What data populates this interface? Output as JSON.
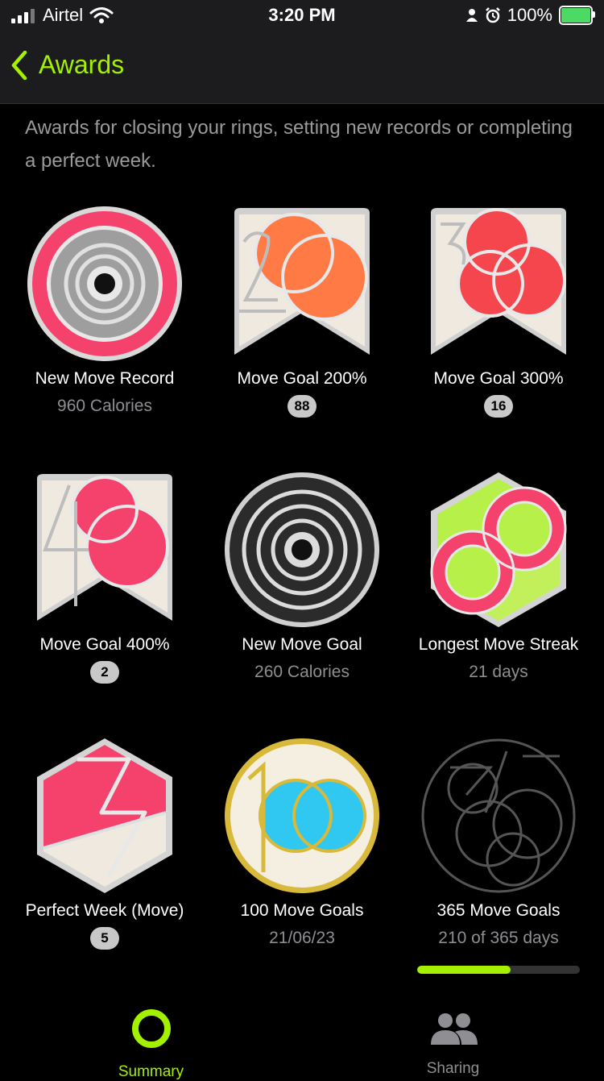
{
  "status": {
    "carrier": "Airtel",
    "time": "3:20 PM",
    "battery": "100%",
    "battery_level": 1.0
  },
  "nav": {
    "title": "Awards"
  },
  "description": "Awards for closing your rings, setting new records or completing a perfect week.",
  "awards": [
    {
      "title": "New Move Record",
      "subtitle": "960 Calories"
    },
    {
      "title": "Move Goal 200%",
      "count": "88"
    },
    {
      "title": "Move Goal 300%",
      "count": "16"
    },
    {
      "title": "Move Goal 400%",
      "count": "2"
    },
    {
      "title": "New Move Goal",
      "subtitle": "260 Calories"
    },
    {
      "title": "Longest Move Streak",
      "subtitle": "21 days"
    },
    {
      "title": "Perfect Week (Move)",
      "count": "5"
    },
    {
      "title": "100 Move Goals",
      "subtitle": "21/06/23"
    },
    {
      "title": "365 Move Goals",
      "subtitle": "210 of 365 days",
      "progress": 0.575
    }
  ],
  "tabs": [
    {
      "label": "Summary",
      "active": true
    },
    {
      "label": "Sharing",
      "active": false
    }
  ],
  "colors": {
    "accent": "#a3f000",
    "secondary_text": "#8e8e93",
    "move_pink": "#f5426c",
    "orange": "#ff7a45",
    "cyan": "#30c8f0"
  }
}
